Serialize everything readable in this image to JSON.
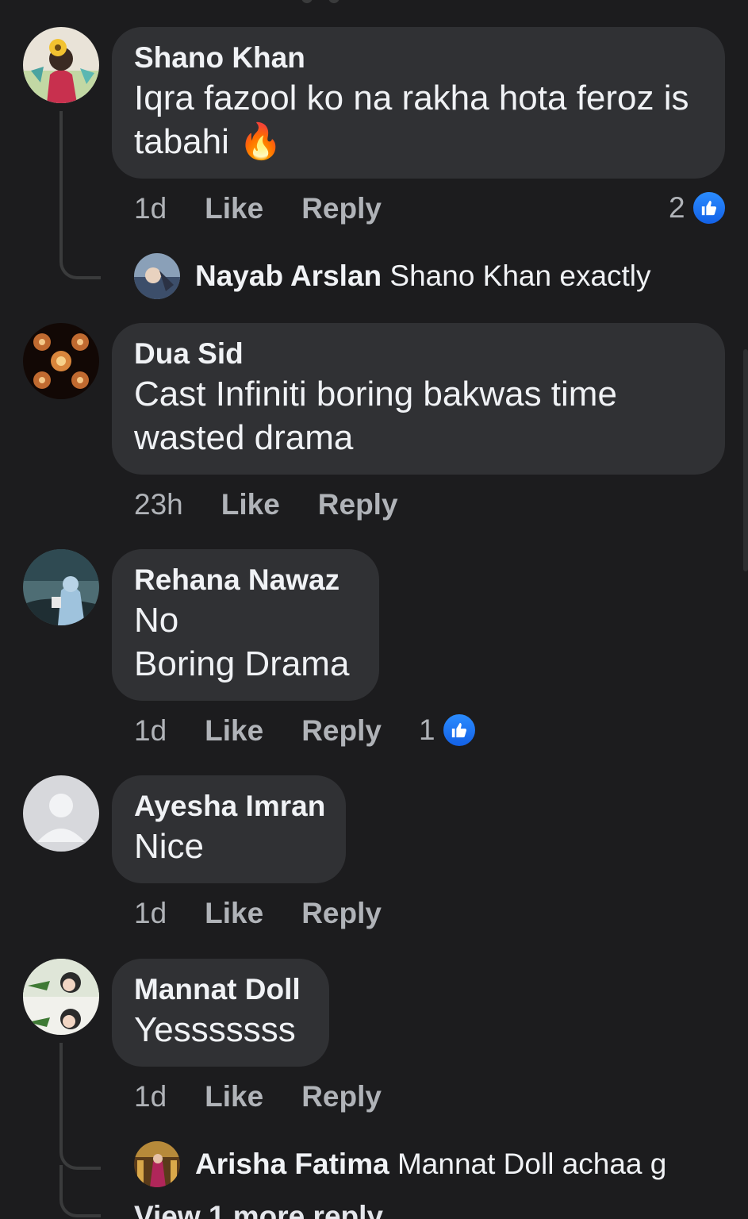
{
  "comments": [
    {
      "author": "Shano Khan",
      "text_lines": [
        "Iqra fazool ko na rakha hota feroz is",
        "tabahi 🔥"
      ],
      "time": "1d",
      "like_label": "Like",
      "reply_label": "Reply",
      "reactions": "2",
      "reply": {
        "author": "Nayab Arslan",
        "text": "Shano Khan exactly"
      }
    },
    {
      "author": "Dua Sid",
      "text_lines": [
        "Cast Infiniti boring bakwas time",
        "wasted drama"
      ],
      "time": "23h",
      "like_label": "Like",
      "reply_label": "Reply"
    },
    {
      "author": "Rehana Nawaz",
      "text_lines": [
        "No",
        "Boring Drama"
      ],
      "time": "1d",
      "like_label": "Like",
      "reply_label": "Reply",
      "reactions": "1"
    },
    {
      "author": "Ayesha Imran",
      "text_lines": [
        "Nice"
      ],
      "time": "1d",
      "like_label": "Like",
      "reply_label": "Reply"
    },
    {
      "author": "Mannat Doll",
      "text_lines": [
        "Yesssssss"
      ],
      "time": "1d",
      "like_label": "Like",
      "reply_label": "Reply",
      "reply": {
        "author": "Arisha Fatima",
        "text": "Mannat Doll achaa g"
      },
      "more_replies": "View 1 more reply"
    }
  ],
  "icons": {
    "like_reaction": "thumbs-up-icon",
    "default_avatar": "person-silhouette-icon"
  },
  "colors": {
    "background": "#1c1c1e",
    "bubble": "#303134",
    "muted_text": "#b0b3b8",
    "like_blue": "#2b8cff"
  }
}
